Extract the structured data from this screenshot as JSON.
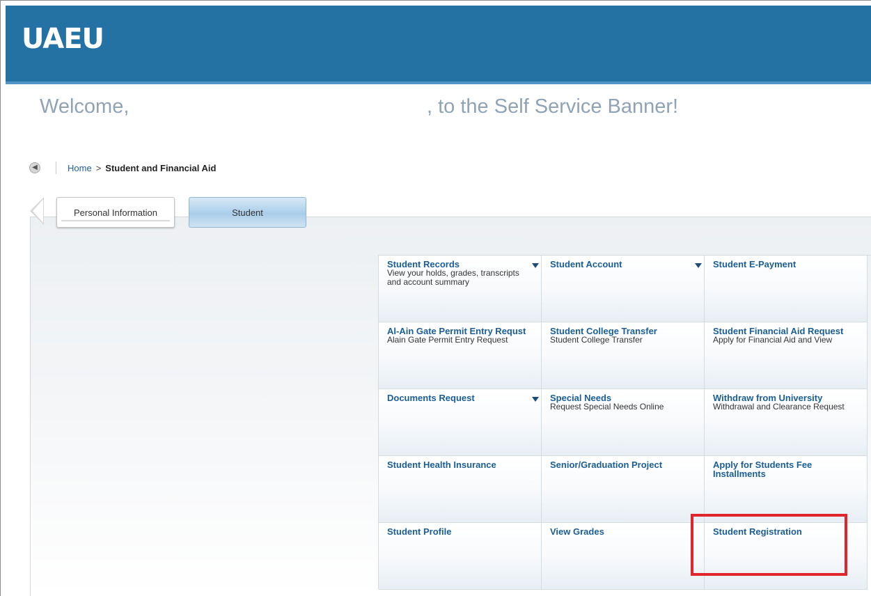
{
  "header": {
    "logo": "UAEU"
  },
  "welcome": {
    "greeting": "Welcome,",
    "suffix": ", to the Self Service Banner!"
  },
  "breadcrumb": {
    "home": "Home",
    "separator": ">",
    "current": "Student and Financial Aid"
  },
  "tabs": [
    {
      "label": "Personal Information",
      "selected": false
    },
    {
      "label": "Student",
      "selected": true
    }
  ],
  "tiles": [
    {
      "title": "Student Records",
      "desc": "View your holds, grades, transcripts and account summary",
      "dropdown": true
    },
    {
      "title": "Student Account",
      "desc": "",
      "dropdown": true
    },
    {
      "title": "Student E-Payment",
      "desc": "",
      "dropdown": false
    },
    {
      "title": "Al-Ain Gate Permit Entry Requst",
      "desc": "Alain Gate Permit Entry Request",
      "dropdown": false
    },
    {
      "title": "Student College Transfer",
      "desc": "Student College Transfer",
      "dropdown": false
    },
    {
      "title": "Student Financial Aid Request",
      "desc": "Apply for Financial Aid and View",
      "dropdown": false
    },
    {
      "title": "Documents Request",
      "desc": "",
      "dropdown": true
    },
    {
      "title": "Special Needs",
      "desc": "Request Special Needs Online",
      "dropdown": false
    },
    {
      "title": "Withdraw from University",
      "desc": "Withdrawal and Clearance Request",
      "dropdown": false
    },
    {
      "title": "Student Health Insurance",
      "desc": "",
      "dropdown": false
    },
    {
      "title": "Senior/Graduation Project",
      "desc": "",
      "dropdown": false
    },
    {
      "title": "Apply for Students Fee Installments",
      "desc": "",
      "dropdown": false
    },
    {
      "title": "Student Profile",
      "desc": "",
      "dropdown": false
    },
    {
      "title": "View Grades",
      "desc": "",
      "dropdown": false
    },
    {
      "title": "Student Registration",
      "desc": "",
      "dropdown": false,
      "highlighted": true
    }
  ],
  "colors": {
    "header": "#2472a4",
    "link": "#1a5e94",
    "highlight": "#e1262b"
  }
}
